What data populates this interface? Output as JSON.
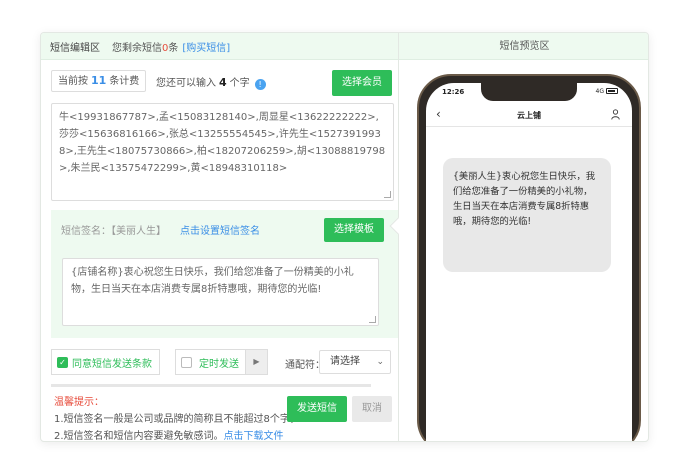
{
  "editor": {
    "title": "短信编辑区",
    "remaining_prefix": "您剩余短信",
    "remaining_count": "0",
    "remaining_suffix": "条",
    "buy_link": "[购买短信]",
    "count_prefix": "当前按",
    "count_value": "11",
    "count_suffix": "条计费",
    "can_input_prefix": "您还可以输入",
    "can_input_value": "4",
    "can_input_suffix": "个字",
    "info_icon_glyph": "!",
    "select_member_label": "选择会员",
    "phone_numbers": "牛<19931867787>,孟<15083128140>,周显星<13622222222>,莎莎<15636816166>,张总<13255554545>,许先生<15273919938>,王先生<18075730866>,柏<18207206259>,胡<13088819798>,朱兰民<13575472299>,黄<18948310118>",
    "signature_label": "短信签名：【美丽人生】",
    "set_signature_link": "点击设置短信签名",
    "select_template_label": "选择模板",
    "message_content": "{店铺名称}衷心祝您生日快乐，我们给您准备了一份精美的小礼物，生日当天在本店消费专属8折特惠哦，期待您的光临!",
    "agree_label": "同意短信发送条款",
    "timed_send_label": "定时发送",
    "wildcard_label": "通配符：",
    "wildcard_select_value": "请选择",
    "tips_title": "温馨提示：",
    "tip_1": "1.短信签名一般是公司或品牌的简称且不能超过8个字，",
    "tip_2_prefix": "2.短信签名和短信内容要避免敏感词。",
    "download_link": "点击下载文件",
    "send_label": "发送短信",
    "cancel_label": "取消"
  },
  "preview": {
    "title": "短信预览区",
    "status_time": "12:26",
    "status_network": "4G",
    "shop_name": "云上铺",
    "back_glyph": "‹",
    "message": "{美丽人生}衷心祝您生日快乐，我们给您准备了一份精美的小礼物，生日当天在本店消费专属8折特惠哦，期待您的光临!"
  },
  "icons": {
    "check_glyph": "✓",
    "arrow_glyph": "▶",
    "caret_glyph": "⌄"
  },
  "colors": {
    "accent_green": "#2ebd59",
    "link_blue": "#3a8ee6",
    "warn_red": "#e74c3c",
    "header_bg": "#eefaf0"
  }
}
